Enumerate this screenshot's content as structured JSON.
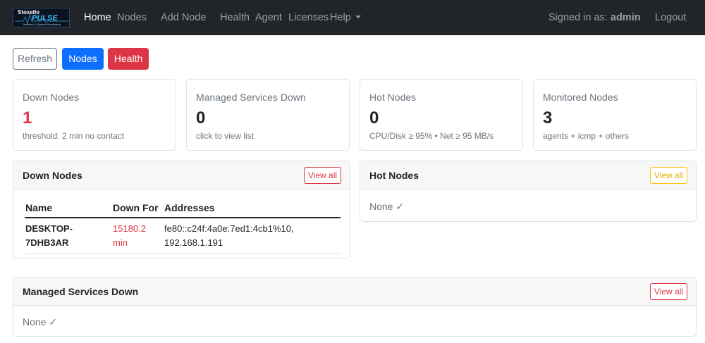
{
  "nav": {
    "logo_title": "Stoxello",
    "logo_name": "PULSE",
    "logo_tagline": "Network & System Monitoring",
    "links": [
      "Home",
      "Nodes",
      "Add Node",
      "Health",
      "Agent",
      "Licenses",
      "Help"
    ],
    "signed_prefix": "Signed in as:",
    "signed_user": "admin",
    "logout": "Logout"
  },
  "actions": {
    "refresh": "Refresh",
    "nodes": "Nodes",
    "health": "Health"
  },
  "stats": [
    {
      "label": "Down Nodes",
      "value": "1",
      "sub": "threshold: 2 min no contact",
      "color": "#dc3545"
    },
    {
      "label": "Managed Services Down",
      "value": "0",
      "sub": "click to view list"
    },
    {
      "label": "Hot Nodes",
      "value": "0",
      "sub": "CPU/Disk ≥ 95% • Net ≥ 95 MB/s"
    },
    {
      "label": "Monitored Nodes",
      "value": "3",
      "sub": "agents + icmp + others"
    }
  ],
  "down_nodes": {
    "title": "Down Nodes",
    "view_all": "View all",
    "columns": [
      "Name",
      "Down For",
      "Addresses"
    ],
    "rows": [
      {
        "name": "DESKTOP-7DHB3AR",
        "down_for": "15180.2 min",
        "addresses": "fe80::c24f:4a0e:7ed1:4cb1%10, 192.168.1.191"
      }
    ]
  },
  "hot_nodes": {
    "title": "Hot Nodes",
    "view_all": "View all",
    "empty": "None ✓"
  },
  "managed_services": {
    "title": "Managed Services Down",
    "view_all": "View all",
    "empty": "None ✓"
  },
  "colors": {
    "navbar": "#212529",
    "primary": "#0d6efd",
    "danger": "#dc3545",
    "warning": "#ffc107",
    "secondary": "#6c757d"
  }
}
